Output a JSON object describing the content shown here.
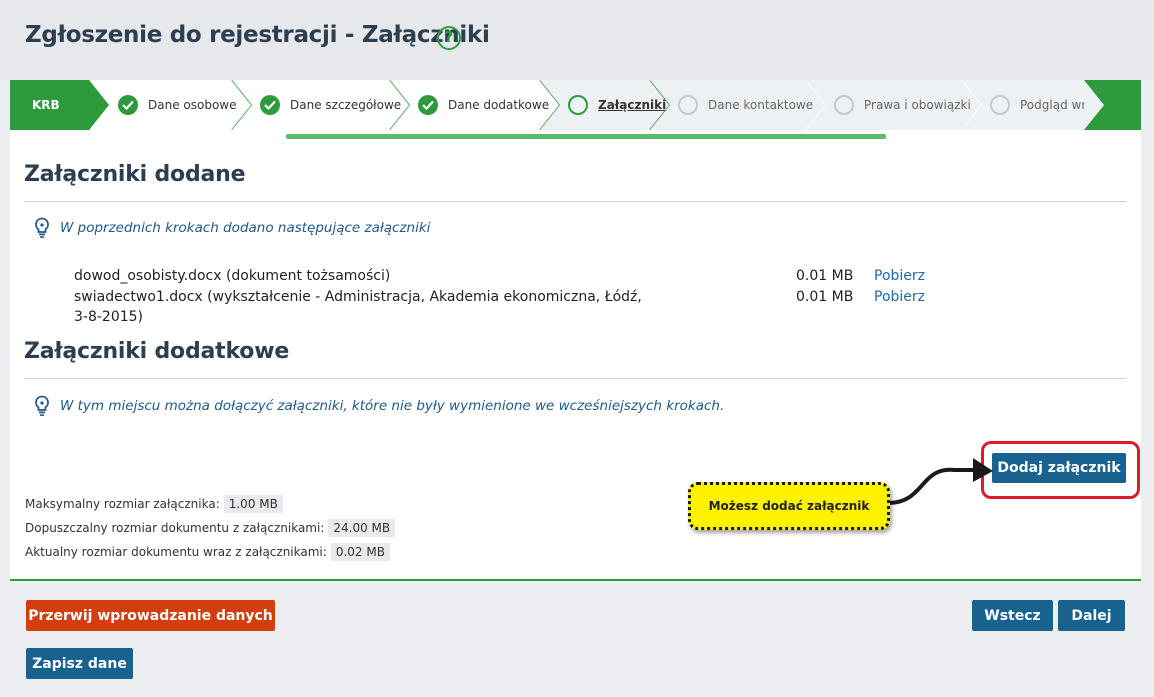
{
  "header": {
    "title": "Zgłoszenie do rejestracji - Załączniki",
    "help_icon": "question-circle-icon"
  },
  "stepper": {
    "root": "KRB",
    "steps": [
      {
        "label": "Dane osobowe",
        "state": "done"
      },
      {
        "label": "Dane szczegółowe",
        "state": "done"
      },
      {
        "label": "Dane dodatkowe",
        "state": "done"
      },
      {
        "label": "Załączniki",
        "state": "current"
      },
      {
        "label": "Dane kontaktowe",
        "state": "todo"
      },
      {
        "label": "Prawa i obowiązki",
        "state": "todo"
      },
      {
        "label": "Podgląd wniosku",
        "state": "todo"
      }
    ]
  },
  "added": {
    "heading": "Załączniki dodane",
    "hint": "W poprzednich krokach dodano następujące załączniki",
    "items": [
      {
        "name": "dowod_osobisty.docx (dokument tożsamości)",
        "size": "0.01 MB",
        "link": "Pobierz"
      },
      {
        "name": "swiadectwo1.docx (wykształcenie - Administracja, Akademia ekonomiczna, Łódź, 3-8-2015)",
        "size": "0.01 MB",
        "link": "Pobierz"
      }
    ]
  },
  "additional": {
    "heading": "Załączniki dodatkowe",
    "hint": "W tym miejscu można dołączyć załączniki, które nie były wymienione we wcześniejszych krokach.",
    "add_button": "Dodaj załącznik",
    "callout": "Możesz dodać załącznik"
  },
  "limits": [
    {
      "label": "Maksymalny rozmiar załącznika:",
      "value": "1.00 MB"
    },
    {
      "label": "Dopuszczalny rozmiar dokumentu z załącznikami:",
      "value": "24.00 MB"
    },
    {
      "label": "Aktualny rozmiar dokumentu wraz z załącznikami:",
      "value": "0.02 MB"
    }
  ],
  "footer": {
    "abort": "Przerwij wprowadzanie danych",
    "save": "Zapisz dane",
    "back": "Wstecz",
    "next": "Dalej"
  },
  "colors": {
    "green": "#2d9b3c",
    "blue": "#17628f",
    "red": "#d23e0f",
    "callout": "#fff200"
  }
}
